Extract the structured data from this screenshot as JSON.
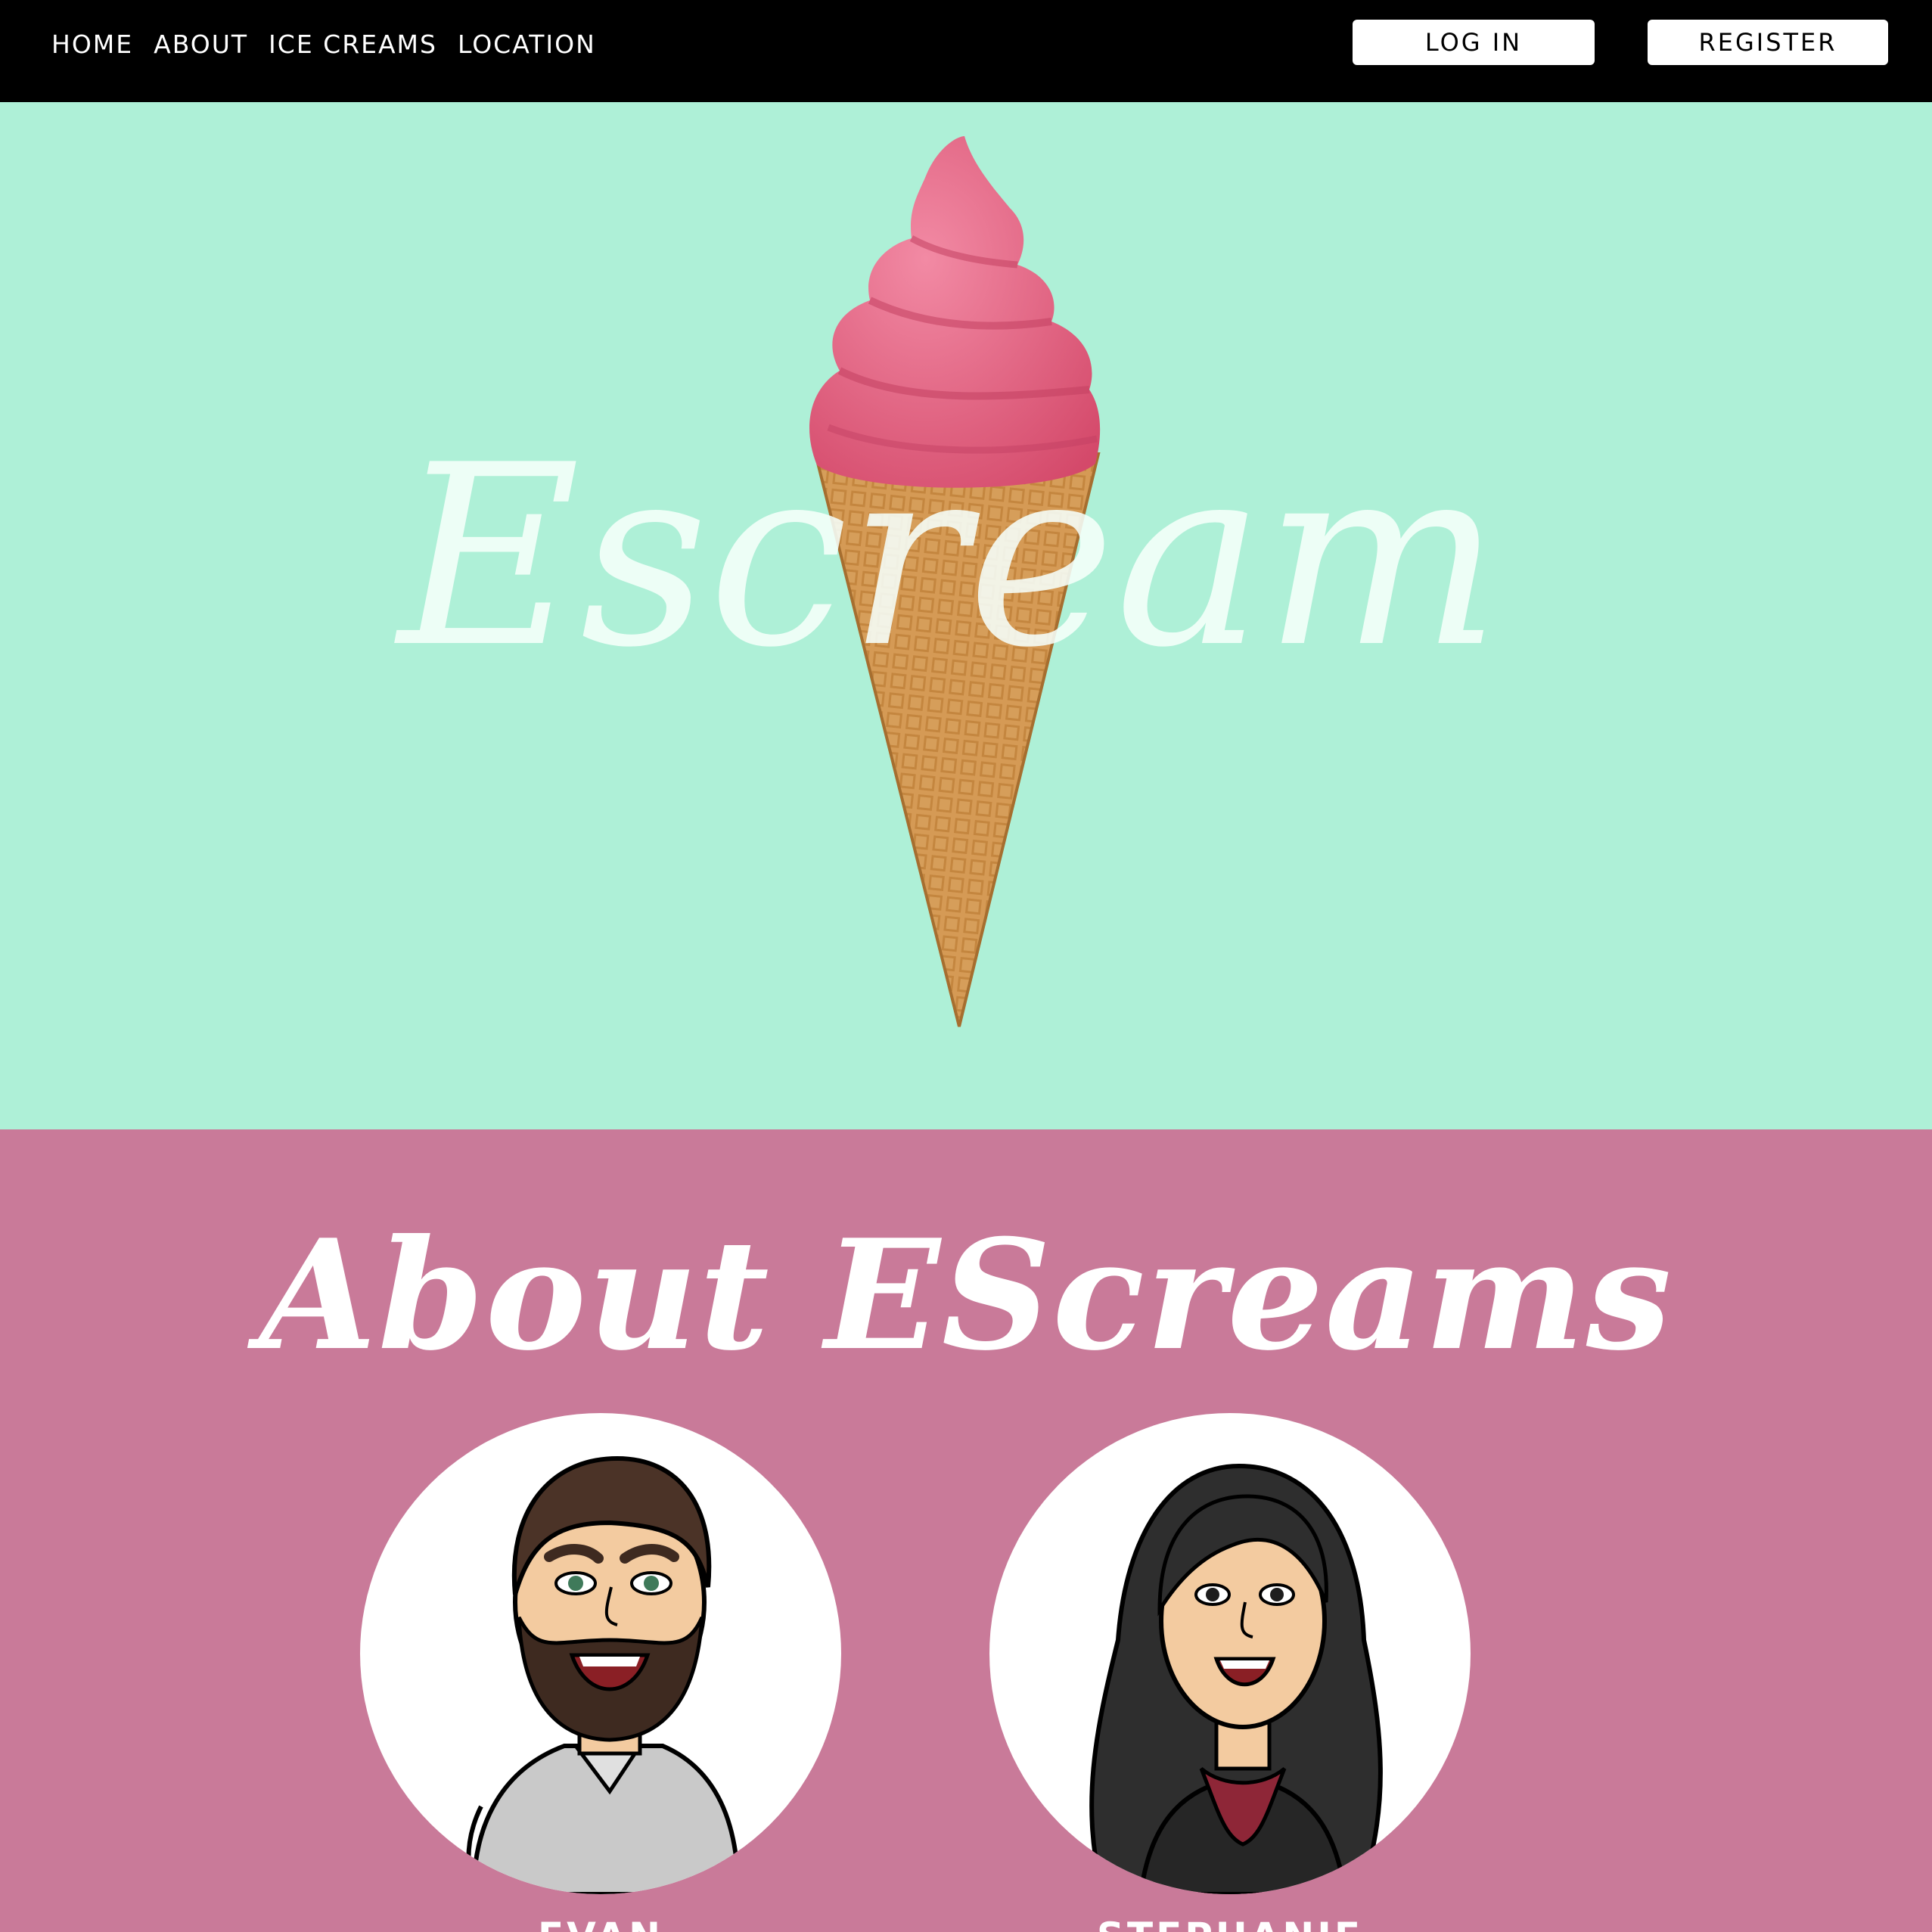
{
  "nav": {
    "links": [
      "HOME",
      "ABOUT",
      "ICE CREAMS",
      "LOCATION"
    ],
    "login_label": "LOG IN",
    "register_label": "REGISTER"
  },
  "hero": {
    "logo_text": "Escream",
    "background_color": "#aef0d7"
  },
  "about": {
    "title": "About EScreams",
    "background_color": "#c97a99",
    "members": [
      {
        "name": "EVAN",
        "icon": "male-avatar-icon"
      },
      {
        "name": "STEPHANIE",
        "icon": "female-avatar-icon"
      }
    ]
  },
  "colors": {
    "navbar": "#000000",
    "ice_cream": "#e55f7f",
    "cone": "#cf9450"
  }
}
